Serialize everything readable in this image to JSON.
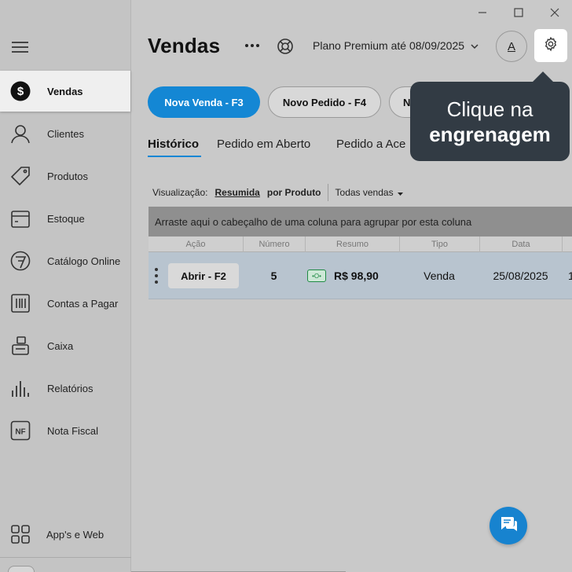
{
  "window": {
    "minimize_icon": "minimize-icon",
    "maximize_icon": "maximize-icon",
    "close_icon": "close-icon"
  },
  "sidebar": {
    "menu_icon": "hamburger-menu-icon",
    "items": [
      {
        "label": "Vendas",
        "icon": "dollar-circle-icon",
        "active": true
      },
      {
        "label": "Clientes",
        "icon": "user-icon"
      },
      {
        "label": "Produtos",
        "icon": "tag-icon"
      },
      {
        "label": "Estoque",
        "icon": "box-icon"
      },
      {
        "label": "Catálogo Online",
        "icon": "catalog-icon"
      },
      {
        "label": "Contas a Pagar",
        "icon": "bill-icon"
      },
      {
        "label": "Caixa",
        "icon": "cash-register-icon"
      },
      {
        "label": "Relatórios",
        "icon": "bar-chart-icon"
      },
      {
        "label": "Nota Fiscal",
        "icon": "nf-icon"
      }
    ],
    "apps_label": "App's e Web"
  },
  "header": {
    "title": "Vendas",
    "plan": "Plano Premium até 08/09/2025",
    "avatar_letter": "A"
  },
  "actions": {
    "primary": "Nova Venda - F3",
    "secondary": "Novo Pedido - F4",
    "third": "N"
  },
  "tabs": [
    {
      "label": "Histórico",
      "active": true
    },
    {
      "label": "Pedido em Aberto"
    },
    {
      "label": "Pedido a Ace"
    }
  ],
  "view": {
    "label": "Visualização:",
    "options": [
      "Resumida",
      "por Produto"
    ],
    "selected": "Resumida",
    "filter": "Todas vendas"
  },
  "grid": {
    "group_hint": "Arraste aqui o cabeçalho de uma coluna para agrupar por esta coluna",
    "columns": [
      "Ação",
      "Número",
      "Resumo",
      "Tipo",
      "Data"
    ],
    "rows": [
      {
        "action": "Abrir - F2",
        "number": "5",
        "summary": "R$ 98,90",
        "type": "Venda",
        "date": "25/08/2025",
        "extra": "1"
      }
    ]
  },
  "tooltip": {
    "line1": "Clique na",
    "line2": "engrenagem"
  },
  "colors": {
    "accent": "#1487d4",
    "tooltip_bg": "#323b44",
    "money_green": "#1f8a44"
  }
}
